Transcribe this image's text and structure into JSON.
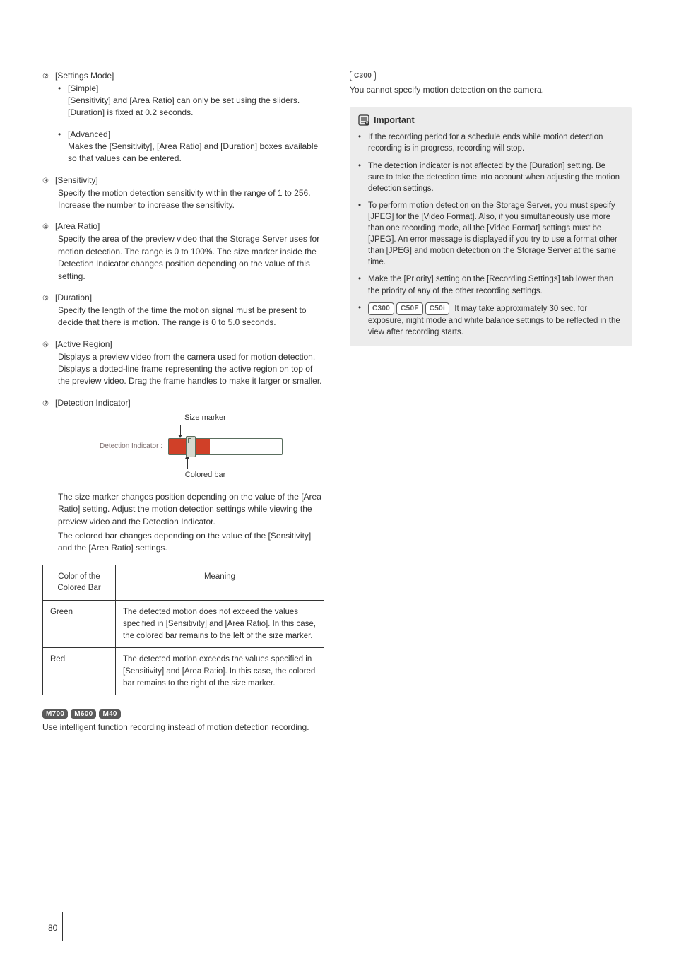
{
  "left": {
    "items": [
      {
        "num": "②",
        "title": "[Settings Mode]",
        "subs": [
          {
            "title": "[Simple]",
            "body": "[Sensitivity] and [Area Ratio] can only be set using the sliders. [Duration] is fixed at 0.2 seconds."
          },
          {
            "title": "[Advanced]",
            "body": "Makes the [Sensitivity], [Area Ratio] and [Duration] boxes available so that values can be entered."
          }
        ]
      },
      {
        "num": "③",
        "title": "[Sensitivity]",
        "body": "Specify the motion detection sensitivity within the range of 1 to 256. Increase the number to increase the sensitivity."
      },
      {
        "num": "④",
        "title": "[Area Ratio]",
        "body": "Specify the area of the preview video that the Storage Server uses for motion detection. The range is 0 to 100%. The size marker inside the Detection Indicator changes position depending on the value of this setting."
      },
      {
        "num": "⑤",
        "title": "[Duration]",
        "body": "Specify the length of the time the motion signal must be present to decide that there is motion. The range is 0 to 5.0 seconds."
      },
      {
        "num": "⑥",
        "title": "[Active Region]",
        "body": "Displays a preview video from the camera used for motion detection.\nDisplays a dotted-line frame representing the active region on top of the preview video. Drag the frame handles to make it larger or smaller."
      },
      {
        "num": "⑦",
        "title": "[Detection Indicator]"
      }
    ],
    "diagram": {
      "top_label": "Size marker",
      "indicator_label": "Detection Indicator :",
      "bottom_label": "Colored bar"
    },
    "after_diagram_p1": "The size marker changes position depending on the value of the [Area Ratio] setting. Adjust the motion detection settings while viewing the preview video and the Detection Indicator.",
    "after_diagram_p2": "The colored bar changes depending on the value of the [Sensitivity] and the [Area Ratio] settings.",
    "table": {
      "head_a": "Color of the Colored Bar",
      "head_b": "Meaning",
      "rows": [
        {
          "a": "Green",
          "b": "The detected motion does not exceed the values specified in [Sensitivity] and [Area Ratio]. In this case, the colored bar remains to the left of the size marker."
        },
        {
          "a": "Red",
          "b": "The detected motion exceeds the values specified in [Sensitivity] and [Area Ratio]. In this case, the colored bar remains to the right of the size marker."
        }
      ]
    },
    "badges1": [
      "M700",
      "M600",
      "M40"
    ],
    "badges1_text": "Use intelligent function recording instead of motion detection recording."
  },
  "right": {
    "top_badge": "C300",
    "top_text": "You cannot specify motion detection on the camera.",
    "important_title": "Important",
    "important_items": [
      "If the recording period for a schedule ends while motion detection recording is in progress, recording will stop.",
      "The detection indicator is not affected by the [Duration] setting. Be sure to take the detection time into account when adjusting the motion detection settings.",
      "To perform motion detection on the Storage Server, you must specify [JPEG] for the [Video Format]. Also, if you simultaneously use more than one recording mode, all the [Video Format] settings must be [JPEG]. An error message is displayed if you try to use a format other than [JPEG] and motion detection on the Storage Server at the same time.",
      "Make the [Priority] setting on the [Recording Settings] tab lower than the priority of any of the other recording settings."
    ],
    "important_last_badges": [
      "C300",
      "C50F",
      "C50i"
    ],
    "important_last_text": " It may take approximately 30 sec. for exposure, night mode and white balance settings to be reflected in the view after recording starts."
  },
  "pageNumber": "80"
}
